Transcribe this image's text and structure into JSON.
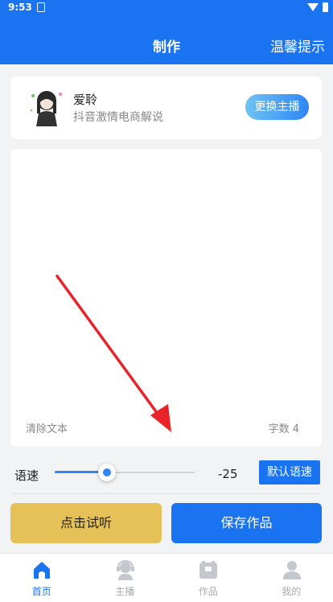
{
  "status_bar": {
    "time": "9:53"
  },
  "header": {
    "title": "制作",
    "tips_label": "温馨提示"
  },
  "anchor": {
    "name": "爱聆",
    "description": "抖音激情电商解说",
    "change_button": "更换主播"
  },
  "editor": {
    "clear_label": "清除文本",
    "char_count_label": "字数 4"
  },
  "speed": {
    "label": "语速",
    "value": "-25",
    "slider_fraction": 0.37,
    "default_button": "默认语速"
  },
  "actions": {
    "listen_button": "点击试听",
    "save_button": "保存作品"
  },
  "bottom_nav": {
    "items": [
      {
        "label": "首页",
        "icon": "home-icon",
        "active": true
      },
      {
        "label": "主播",
        "icon": "anchor-icon",
        "active": false
      },
      {
        "label": "作品",
        "icon": "works-icon",
        "active": false
      },
      {
        "label": "我的",
        "icon": "profile-icon",
        "active": false
      }
    ]
  },
  "colors": {
    "primary": "#1a73f0",
    "listen_button": "#e6c157",
    "annotation_arrow": "#e8242a"
  }
}
